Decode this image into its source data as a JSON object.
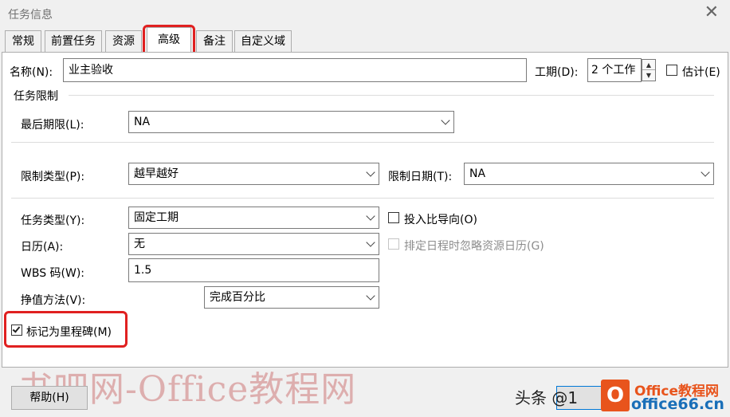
{
  "window": {
    "title": "任务信息",
    "close_glyph": "✕"
  },
  "tabs": [
    {
      "label": "常规"
    },
    {
      "label": "前置任务"
    },
    {
      "label": "资源"
    },
    {
      "label": "高级",
      "active": true
    },
    {
      "label": "备注"
    },
    {
      "label": "自定义域"
    }
  ],
  "name": {
    "label": "名称(N):",
    "value": "业主验收"
  },
  "duration": {
    "label": "工期(D):",
    "value": "2 个工作"
  },
  "estimate": {
    "label": "估计(E)",
    "checked": false
  },
  "constraints": {
    "section_label": "任务限制",
    "deadline_label": "最后期限(L):",
    "deadline_value": "NA",
    "type_label": "限制类型(P):",
    "type_value": "越早越好",
    "date_label": "限制日期(T):",
    "date_value": "NA"
  },
  "task_type": {
    "label": "任务类型(Y):",
    "value": "固定工期"
  },
  "effort_driven": {
    "label": "投入比导向(O)",
    "checked": false
  },
  "calendar": {
    "label": "日历(A):",
    "value": "无"
  },
  "ignore_resource_calendars": {
    "label": "排定日程时忽略资源日历(G)",
    "checked": false,
    "disabled": true
  },
  "wbs": {
    "label": "WBS 码(W):",
    "value": "1.5"
  },
  "earned_value": {
    "label": "挣值方法(V):",
    "value": "完成百分比"
  },
  "milestone": {
    "label": "标记为里程碑(M)",
    "checked": true
  },
  "footer": {
    "help_label": "帮助(H)"
  },
  "overlays": {
    "watermark_text": "书吧网-Office教程网",
    "credit_text": "头条 @1",
    "logo_line1": "Office教程网",
    "logo_line2": "office66.cn",
    "logo_letter": "O"
  },
  "colors": {
    "highlight": "#e02020",
    "logo_orange": "#e8541c",
    "logo_blue": "#1a6fb8"
  }
}
